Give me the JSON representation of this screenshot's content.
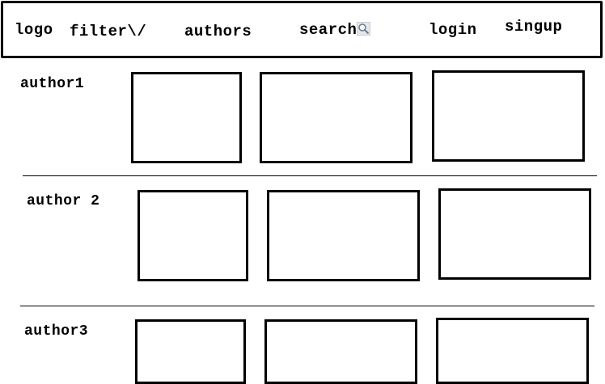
{
  "nav": {
    "logo": "logo",
    "filter": "filter\\/",
    "authors": "authors",
    "search": "search",
    "search_icon": "search-icon",
    "login": "login",
    "signup": "singup"
  },
  "authors": [
    {
      "label": "author1",
      "card_count": 3
    },
    {
      "label": "author 2",
      "card_count": 3
    },
    {
      "label": "author3",
      "card_count": 3
    }
  ]
}
